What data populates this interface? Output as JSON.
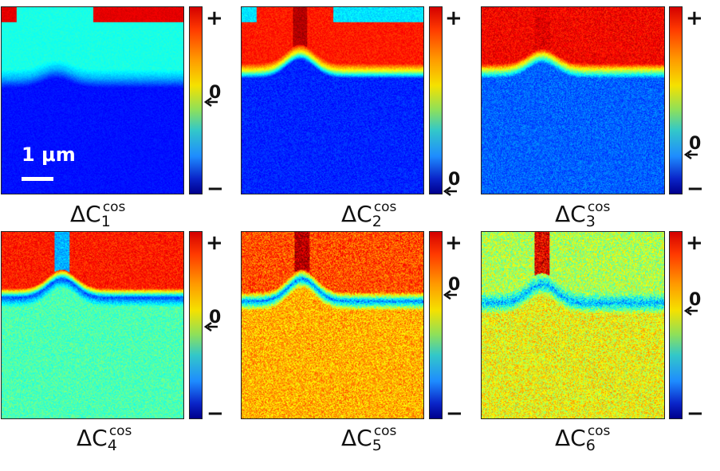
{
  "panels": [
    {
      "label_base": "ΔC",
      "label_sub": "1",
      "label_sup": "cos",
      "zero_label": "0",
      "plus_label": "+",
      "minus_label": "−"
    },
    {
      "label_base": "ΔC",
      "label_sub": "2",
      "label_sup": "cos",
      "zero_label": "0",
      "plus_label": "+",
      "minus_label": "−"
    },
    {
      "label_base": "ΔC",
      "label_sub": "3",
      "label_sup": "cos",
      "zero_label": "0",
      "plus_label": "+",
      "minus_label": "−"
    },
    {
      "label_base": "ΔC",
      "label_sub": "4",
      "label_sup": "cos",
      "zero_label": "0",
      "plus_label": "+",
      "minus_label": "−"
    },
    {
      "label_base": "ΔC",
      "label_sub": "5",
      "label_sup": "cos",
      "zero_label": "0",
      "plus_label": "+",
      "minus_label": "−"
    },
    {
      "label_base": "ΔC",
      "label_sub": "6",
      "label_sup": "cos",
      "zero_label": "0",
      "plus_label": "+",
      "minus_label": "−"
    }
  ],
  "scalebar": {
    "label": "1 μm"
  },
  "colormap": "jet"
}
